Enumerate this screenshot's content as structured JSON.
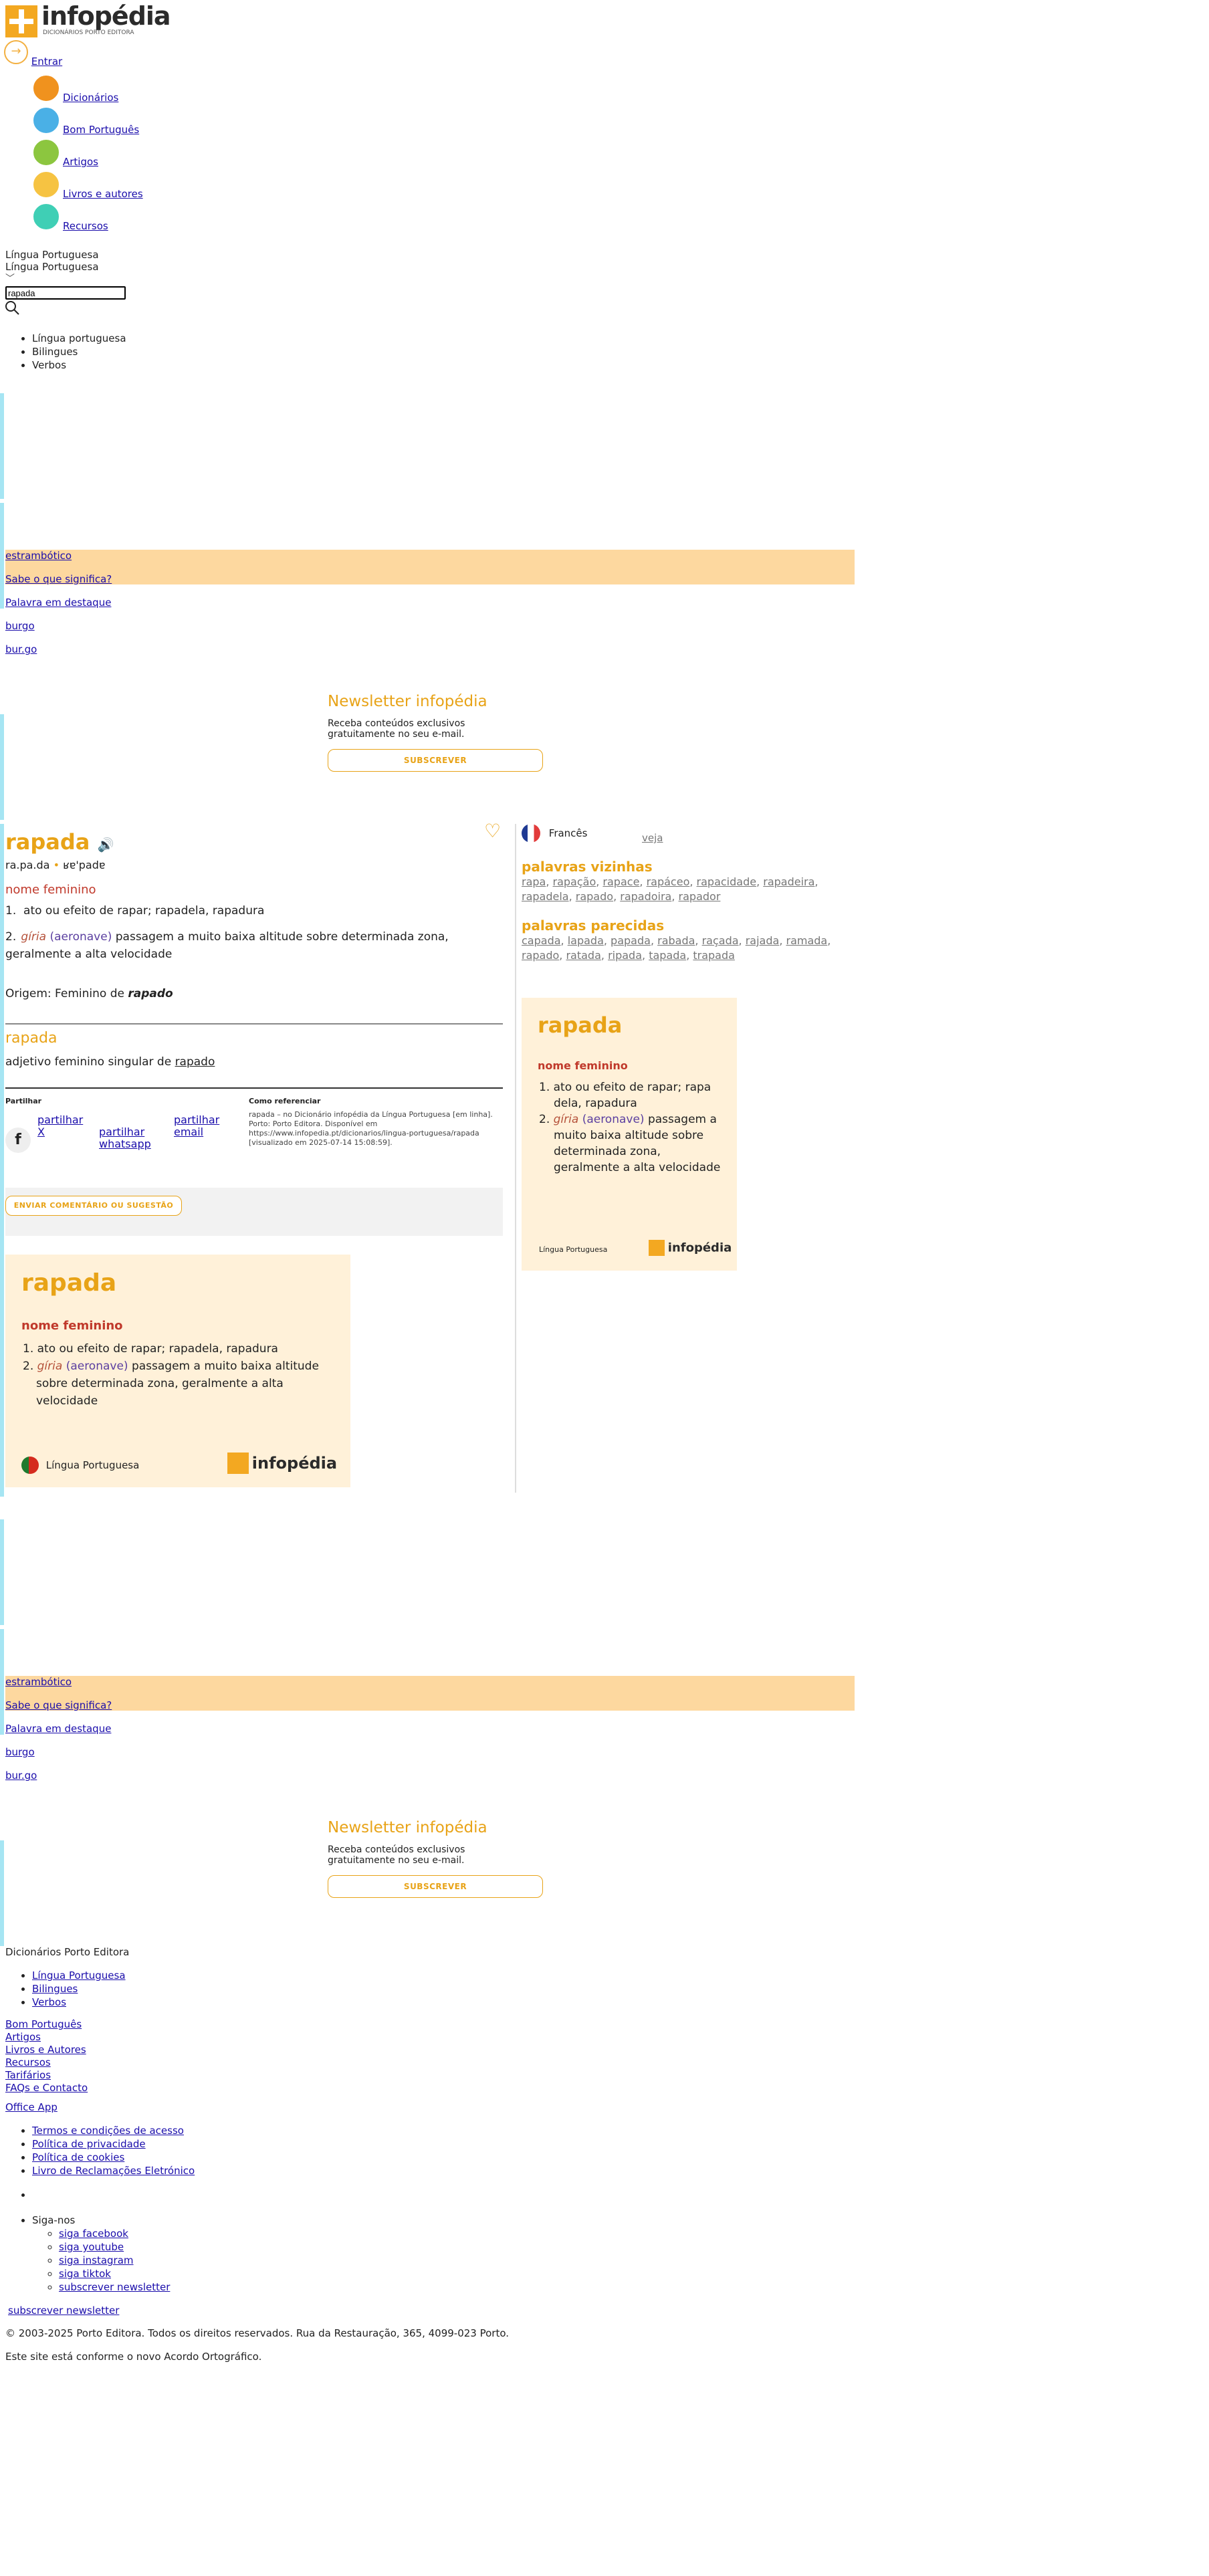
{
  "header": {
    "logo_text": "infopédia",
    "logo_sub": "DICIONÁRIOS PORTO EDITORA",
    "login_label": "Entrar",
    "nav": [
      {
        "label": "Dicionários",
        "icon": "book-icon",
        "color": "#f0921e"
      },
      {
        "label": "Bom Português",
        "icon": "pencil-icon",
        "color": "#4ab0e6"
      },
      {
        "label": "Artigos",
        "icon": "document-icon",
        "color": "#8cc63f"
      },
      {
        "label": "Livros e autores",
        "icon": "books-icon",
        "color": "#f6c342"
      },
      {
        "label": "Recursos",
        "icon": "resources-icon",
        "color": "#3fcfb5"
      }
    ],
    "dictionary_select": "Língua Portuguesa",
    "dictionary_select_2": "Língua Portuguesa",
    "search_value": "rapada",
    "dict_options": [
      "Língua portuguesa",
      "Bilingues",
      "Verbos"
    ]
  },
  "promo": {
    "word_of_day": "estrambótico",
    "know_meaning": "Sabe o que significa?",
    "featured_label": "Palavra em destaque",
    "featured_word": "burgo",
    "featured_syll": "bur.go",
    "newsletter_title": "Newsletter infopédia",
    "newsletter_text": "Receba conteúdos exclusivos gratuitamente no seu e-mail.",
    "subscribe_button": "SUBSCREVER"
  },
  "entry": {
    "headword": "rapada",
    "syllables": "ra.pa.da",
    "ipa": "ʁɐ'padɐ",
    "pos": "nome feminino",
    "sense1": "ato ou efeito de rapar; rapadela, rapadura",
    "sense2_tag": "gíria",
    "sense2_domain": "(aeronave)",
    "sense2_text": "passagem a muito baixa altitude sobre determinada zona, geralmente a alta velocidade",
    "origin_label": "Origem: Feminino de",
    "origin_word": "rapado",
    "second_headword": "rapada",
    "second_def": "adjetivo feminino singular de",
    "second_link": "rapado",
    "share_label": "Partilhar",
    "share_x": "partilhar X",
    "share_whatsapp": "partilhar whatsapp",
    "share_email": "partilhar email",
    "cite_label": "Como referenciar",
    "cite_text": "rapada – no Dicionário infopédia da Língua Portuguesa [em linha]. Porto: Porto Editora. Disponível em https://www.infopedia.pt/dicionarios/lingua-portuguesa/rapada [visualizado em 2025-07-14 15:08:59].",
    "comment_button": "ENVIAR COMENTÁRIO OU SUGESTÃO"
  },
  "sidebar": {
    "language": "Francês",
    "see_label": "veja",
    "neighbors_title": "palavras vizinhas",
    "neighbors": [
      "rapa",
      "rapação",
      "rapace",
      "rapáceo",
      "rapacidade",
      "rapadeira",
      "rapadela",
      "rapado",
      "rapadoira",
      "rapador"
    ],
    "similar_title": "palavras parecidas",
    "similar": [
      "capada",
      "lapada",
      "papada",
      "rabada",
      "raçada",
      "rajada",
      "ramada",
      "rapado",
      "ratada",
      "ripada",
      "tapada",
      "trapada"
    ]
  },
  "card": {
    "word": "rapada",
    "pos": "nome feminino",
    "sense1": "ato ou efeito de rapar; rapadela, rapadura",
    "sense1_narrow": "ato ou efeito de rapar; rapa dela, rapadura",
    "sense2_tag": "gíria",
    "sense2_domain": "(aeronave)",
    "sense2_text": "passagem a muito baixa altitude sobre determinada zona, geralmente a alta velocidade",
    "footer_label": "Língua Portuguesa",
    "brand": "infopédia"
  },
  "footer": {
    "brand": "Dicionários Porto Editora",
    "dicts": [
      "Língua Portuguesa",
      "Bilingues",
      "Verbos"
    ],
    "links": [
      "Bom Português",
      "Artigos",
      "Livros e Autores",
      "Recursos",
      "Tarifários",
      "FAQs e Contacto"
    ],
    "office": "Office App",
    "legal": [
      "Termos e condições de acesso",
      "Política de privacidade",
      "Política de cookies",
      "Livro de Reclamações Eletrónico"
    ],
    "follow": "Siga-nos",
    "social": [
      "siga facebook",
      "siga youtube",
      "siga instagram",
      "siga tiktok",
      "subscrever newsletter"
    ],
    "subscribe_link": "subscrever newsletter",
    "copyright": "© 2003-2025 Porto Editora. Todos os direitos reservados. Rua da Restauração, 365, 4099-023 Porto.",
    "ortho": "Este site está conforme o novo Acordo Ortográfico."
  },
  "colors": {
    "accent": "#e8a317",
    "band": "#fdd89f",
    "card": "#fff1d9",
    "adband": "#a6e5f3"
  }
}
